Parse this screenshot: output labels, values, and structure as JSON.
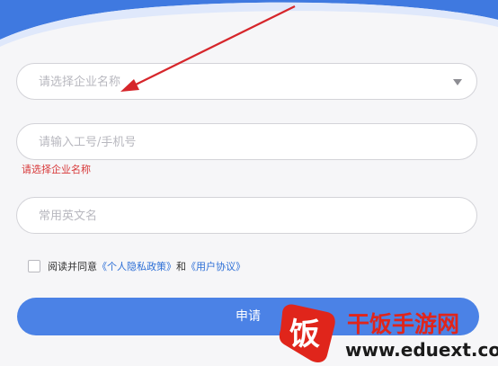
{
  "form": {
    "company_placeholder": "请选择企业名称",
    "id_placeholder": "请输入工号/手机号",
    "company_error": "请选择企业名称",
    "english_name_placeholder": "常用英文名",
    "agree_prefix": "阅读并同意",
    "privacy_link": "《个人隐私政策》",
    "agree_and": "和",
    "user_agreement_link": "《用户协议》",
    "submit_label": "申请"
  },
  "watermark": {
    "logo_char": "饭",
    "name": "干饭手游网",
    "url": "www.eduext.com"
  },
  "colors": {
    "primary": "#4b82e6",
    "error": "#d8393a",
    "link": "#2d6fd6",
    "annotation_arrow": "#d6262b"
  },
  "icons": {
    "dropdown": "chevron-down-icon",
    "checkbox": "checkbox-icon"
  }
}
